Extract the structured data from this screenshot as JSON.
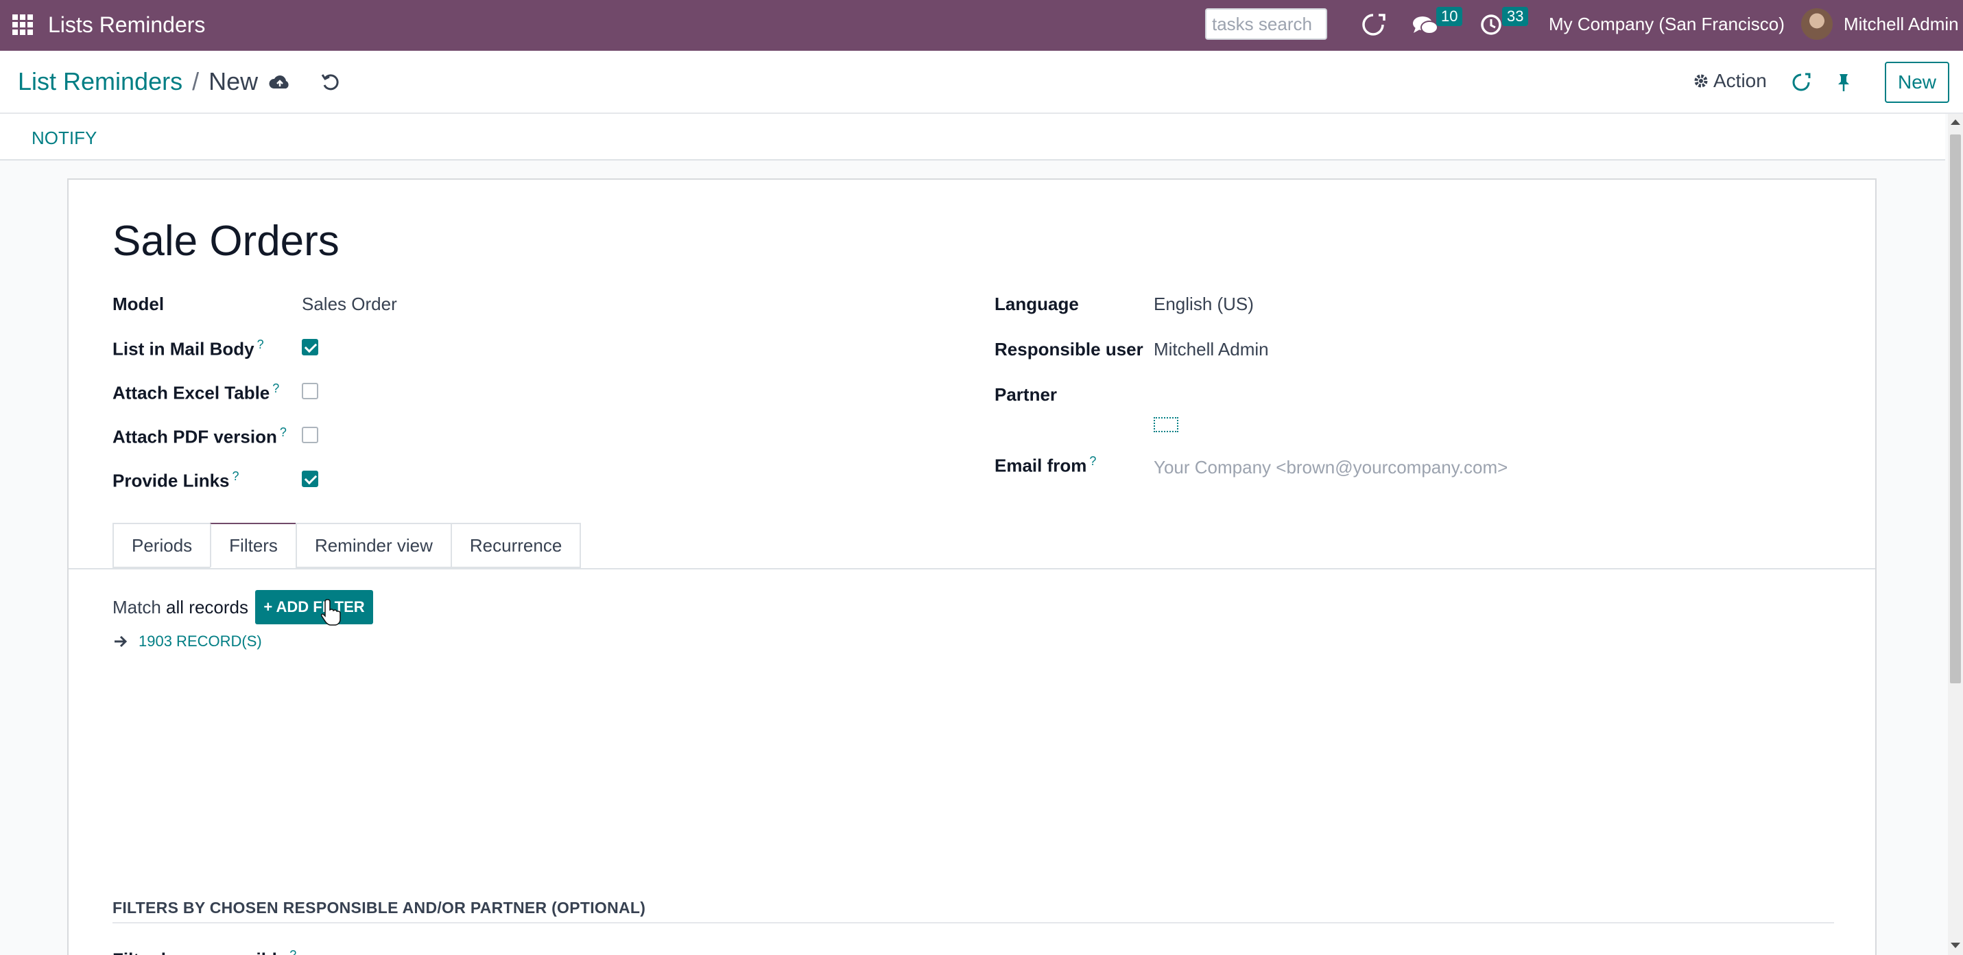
{
  "navbar": {
    "app_title": "Lists Reminders",
    "search_placeholder": "tasks search",
    "messages_count": "10",
    "activities_count": "33",
    "company": "My Company (San Francisco)",
    "user": "Mitchell Admin"
  },
  "control_panel": {
    "breadcrumb_parent": "List Reminders",
    "breadcrumb_separator": "/",
    "breadcrumb_current": "New",
    "action_label": "Action",
    "new_label": "New"
  },
  "statusbar": {
    "notify_label": "NOTIFY"
  },
  "form": {
    "title": "Sale Orders",
    "left_fields": {
      "model_label": "Model",
      "model_value": "Sales Order",
      "list_in_mail_body_label": "List in Mail Body",
      "list_in_mail_body_checked": true,
      "attach_excel_label": "Attach Excel Table",
      "attach_excel_checked": false,
      "attach_pdf_label": "Attach PDF version",
      "attach_pdf_checked": false,
      "provide_links_label": "Provide Links",
      "provide_links_checked": true
    },
    "right_fields": {
      "language_label": "Language",
      "language_value": "English (US)",
      "responsible_label": "Responsible user",
      "responsible_value": "Mitchell Admin",
      "partner_label": "Partner",
      "email_from_label": "Email from",
      "email_from_placeholder": "Your Company <brown@yourcompany.com>"
    },
    "help_mark": "?",
    "tabs": [
      {
        "label": "Periods",
        "active": false
      },
      {
        "label": "Filters",
        "active": true
      },
      {
        "label": "Reminder view",
        "active": false
      },
      {
        "label": "Recurrence",
        "active": false
      }
    ],
    "filters": {
      "match_prefix": "Match",
      "match_scope": "all records",
      "add_filter_label": "+ ADD FILTER",
      "records_label": "1903 RECORD(S)"
    },
    "section_title": "FILTERS BY CHOSEN RESPONSIBLE AND/OR PARTNER (OPTIONAL)",
    "cut_label": "Filter by responsible"
  },
  "colors": {
    "navbar": "#71496a",
    "primary": "#017e84"
  }
}
